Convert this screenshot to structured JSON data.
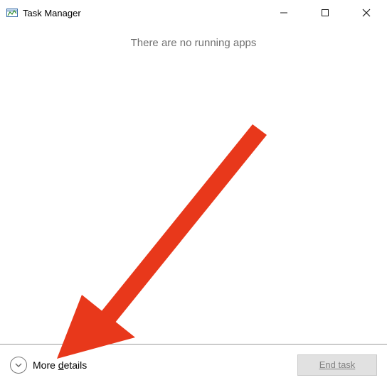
{
  "titlebar": {
    "title": "Task Manager"
  },
  "content": {
    "empty_message": "There are no running apps"
  },
  "bottom": {
    "more_details_prefix": "More ",
    "more_details_underlined": "d",
    "more_details_suffix": "etails",
    "end_task_prefix": "E",
    "end_task_underlined": "n",
    "end_task_suffix": "d task"
  },
  "colors": {
    "arrow": "#e8381b"
  }
}
